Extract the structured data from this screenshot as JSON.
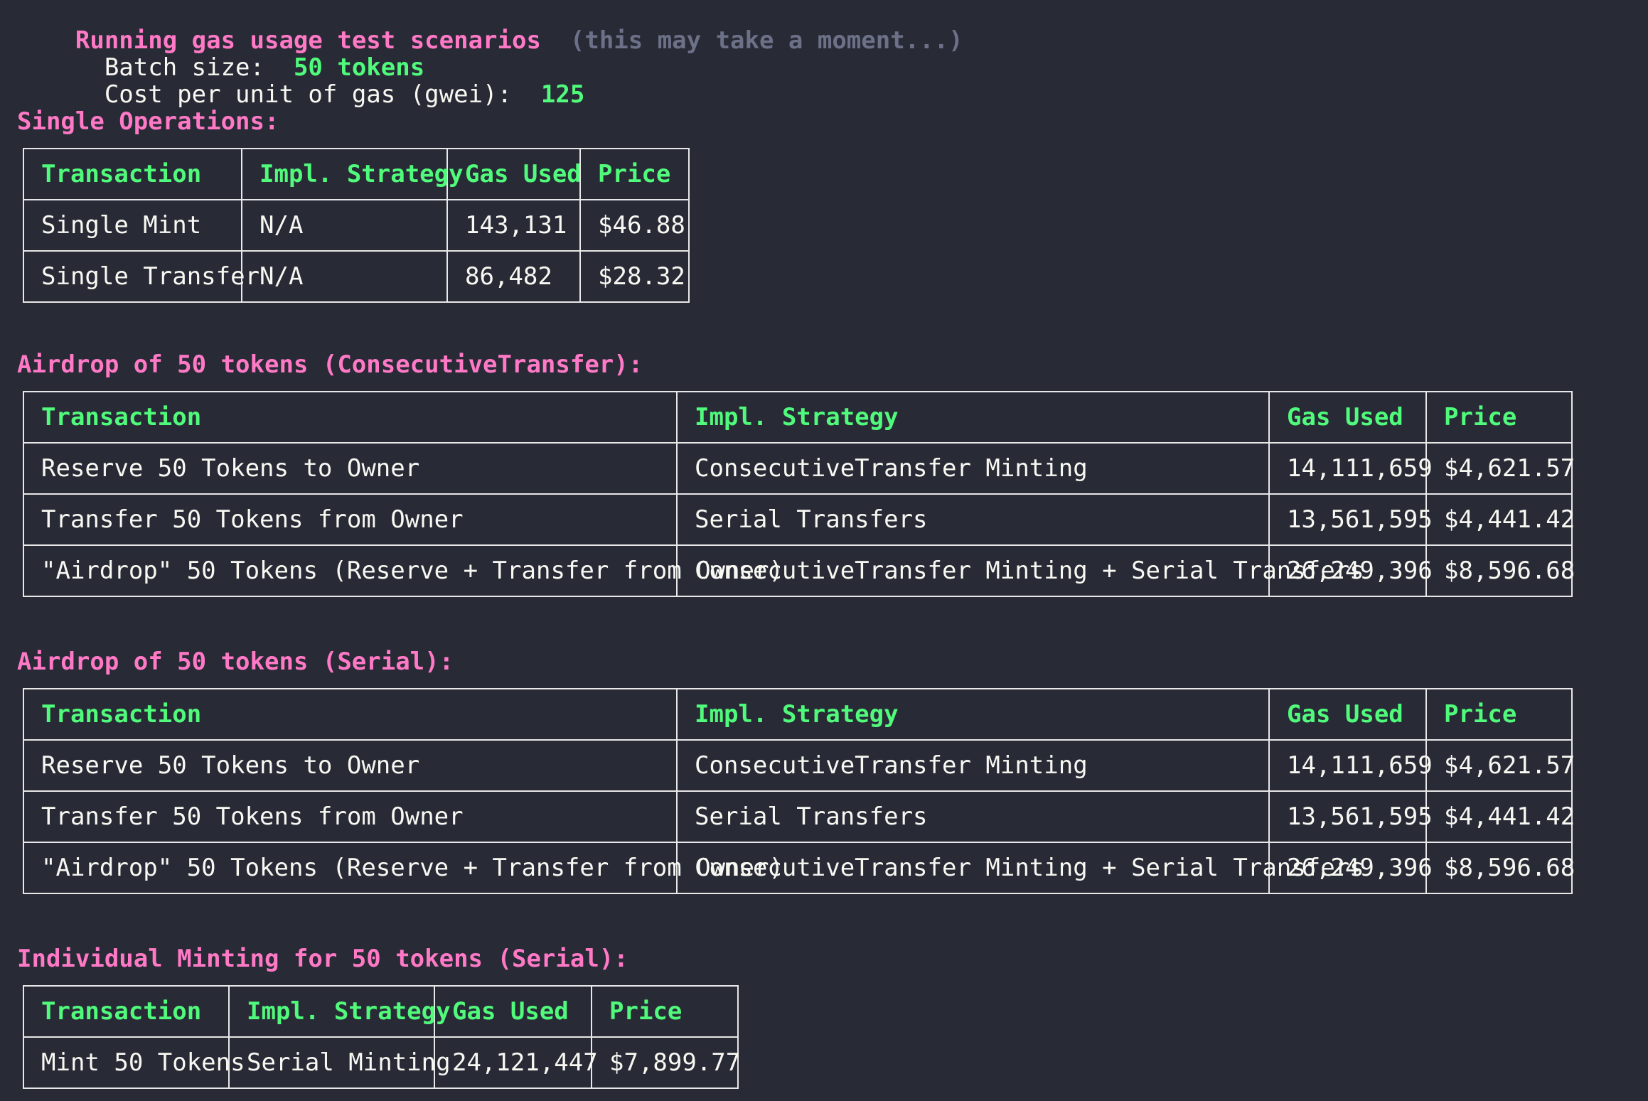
{
  "header": {
    "running_label": "Running gas usage test scenarios",
    "running_note": "(this may take a moment...)",
    "batch_label": "  Batch size:  ",
    "batch_value": "50 tokens",
    "cost_label": "  Cost per unit of gas (gwei):  ",
    "cost_value": "125"
  },
  "sections": [
    {
      "title": "Single Operations:",
      "headers": [
        "Transaction",
        "Impl. Strategy",
        "Gas Used",
        "Price"
      ],
      "rows": [
        [
          "Single Mint",
          "N/A",
          "143,131",
          "$46.88"
        ],
        [
          "Single Transfer",
          "N/A",
          "86,482",
          "$28.32"
        ]
      ]
    },
    {
      "title": "Airdrop of 50 tokens (ConsecutiveTransfer):",
      "headers": [
        "Transaction",
        "Impl. Strategy",
        "Gas Used",
        "Price"
      ],
      "rows": [
        [
          "Reserve 50 Tokens to Owner",
          "ConsecutiveTransfer Minting",
          "14,111,659",
          "$4,621.57"
        ],
        [
          "Transfer 50 Tokens from Owner",
          "Serial Transfers",
          "13,561,595",
          "$4,441.42"
        ],
        [
          "\"Airdrop\" 50 Tokens (Reserve + Transfer from Owner)",
          "ConsecutiveTransfer Minting + Serial Transfers",
          "26,249,396",
          "$8,596.68"
        ]
      ]
    },
    {
      "title": "Airdrop of 50 tokens (Serial):",
      "headers": [
        "Transaction",
        "Impl. Strategy",
        "Gas Used",
        "Price"
      ],
      "rows": [
        [
          "Reserve 50 Tokens to Owner",
          "ConsecutiveTransfer Minting",
          "14,111,659",
          "$4,621.57"
        ],
        [
          "Transfer 50 Tokens from Owner",
          "Serial Transfers",
          "13,561,595",
          "$4,441.42"
        ],
        [
          "\"Airdrop\" 50 Tokens (Reserve + Transfer from Owner)",
          "ConsecutiveTransfer Minting + Serial Transfers",
          "26,249,396",
          "$8,596.68"
        ]
      ]
    },
    {
      "title": "Individual Minting for 50 tokens (Serial):",
      "headers": [
        "Transaction",
        "Impl. Strategy",
        "Gas Used",
        "Price"
      ],
      "rows": [
        [
          "Mint 50 Tokens",
          "Serial Minting",
          "24,121,447",
          "$7,899.77"
        ]
      ]
    }
  ]
}
